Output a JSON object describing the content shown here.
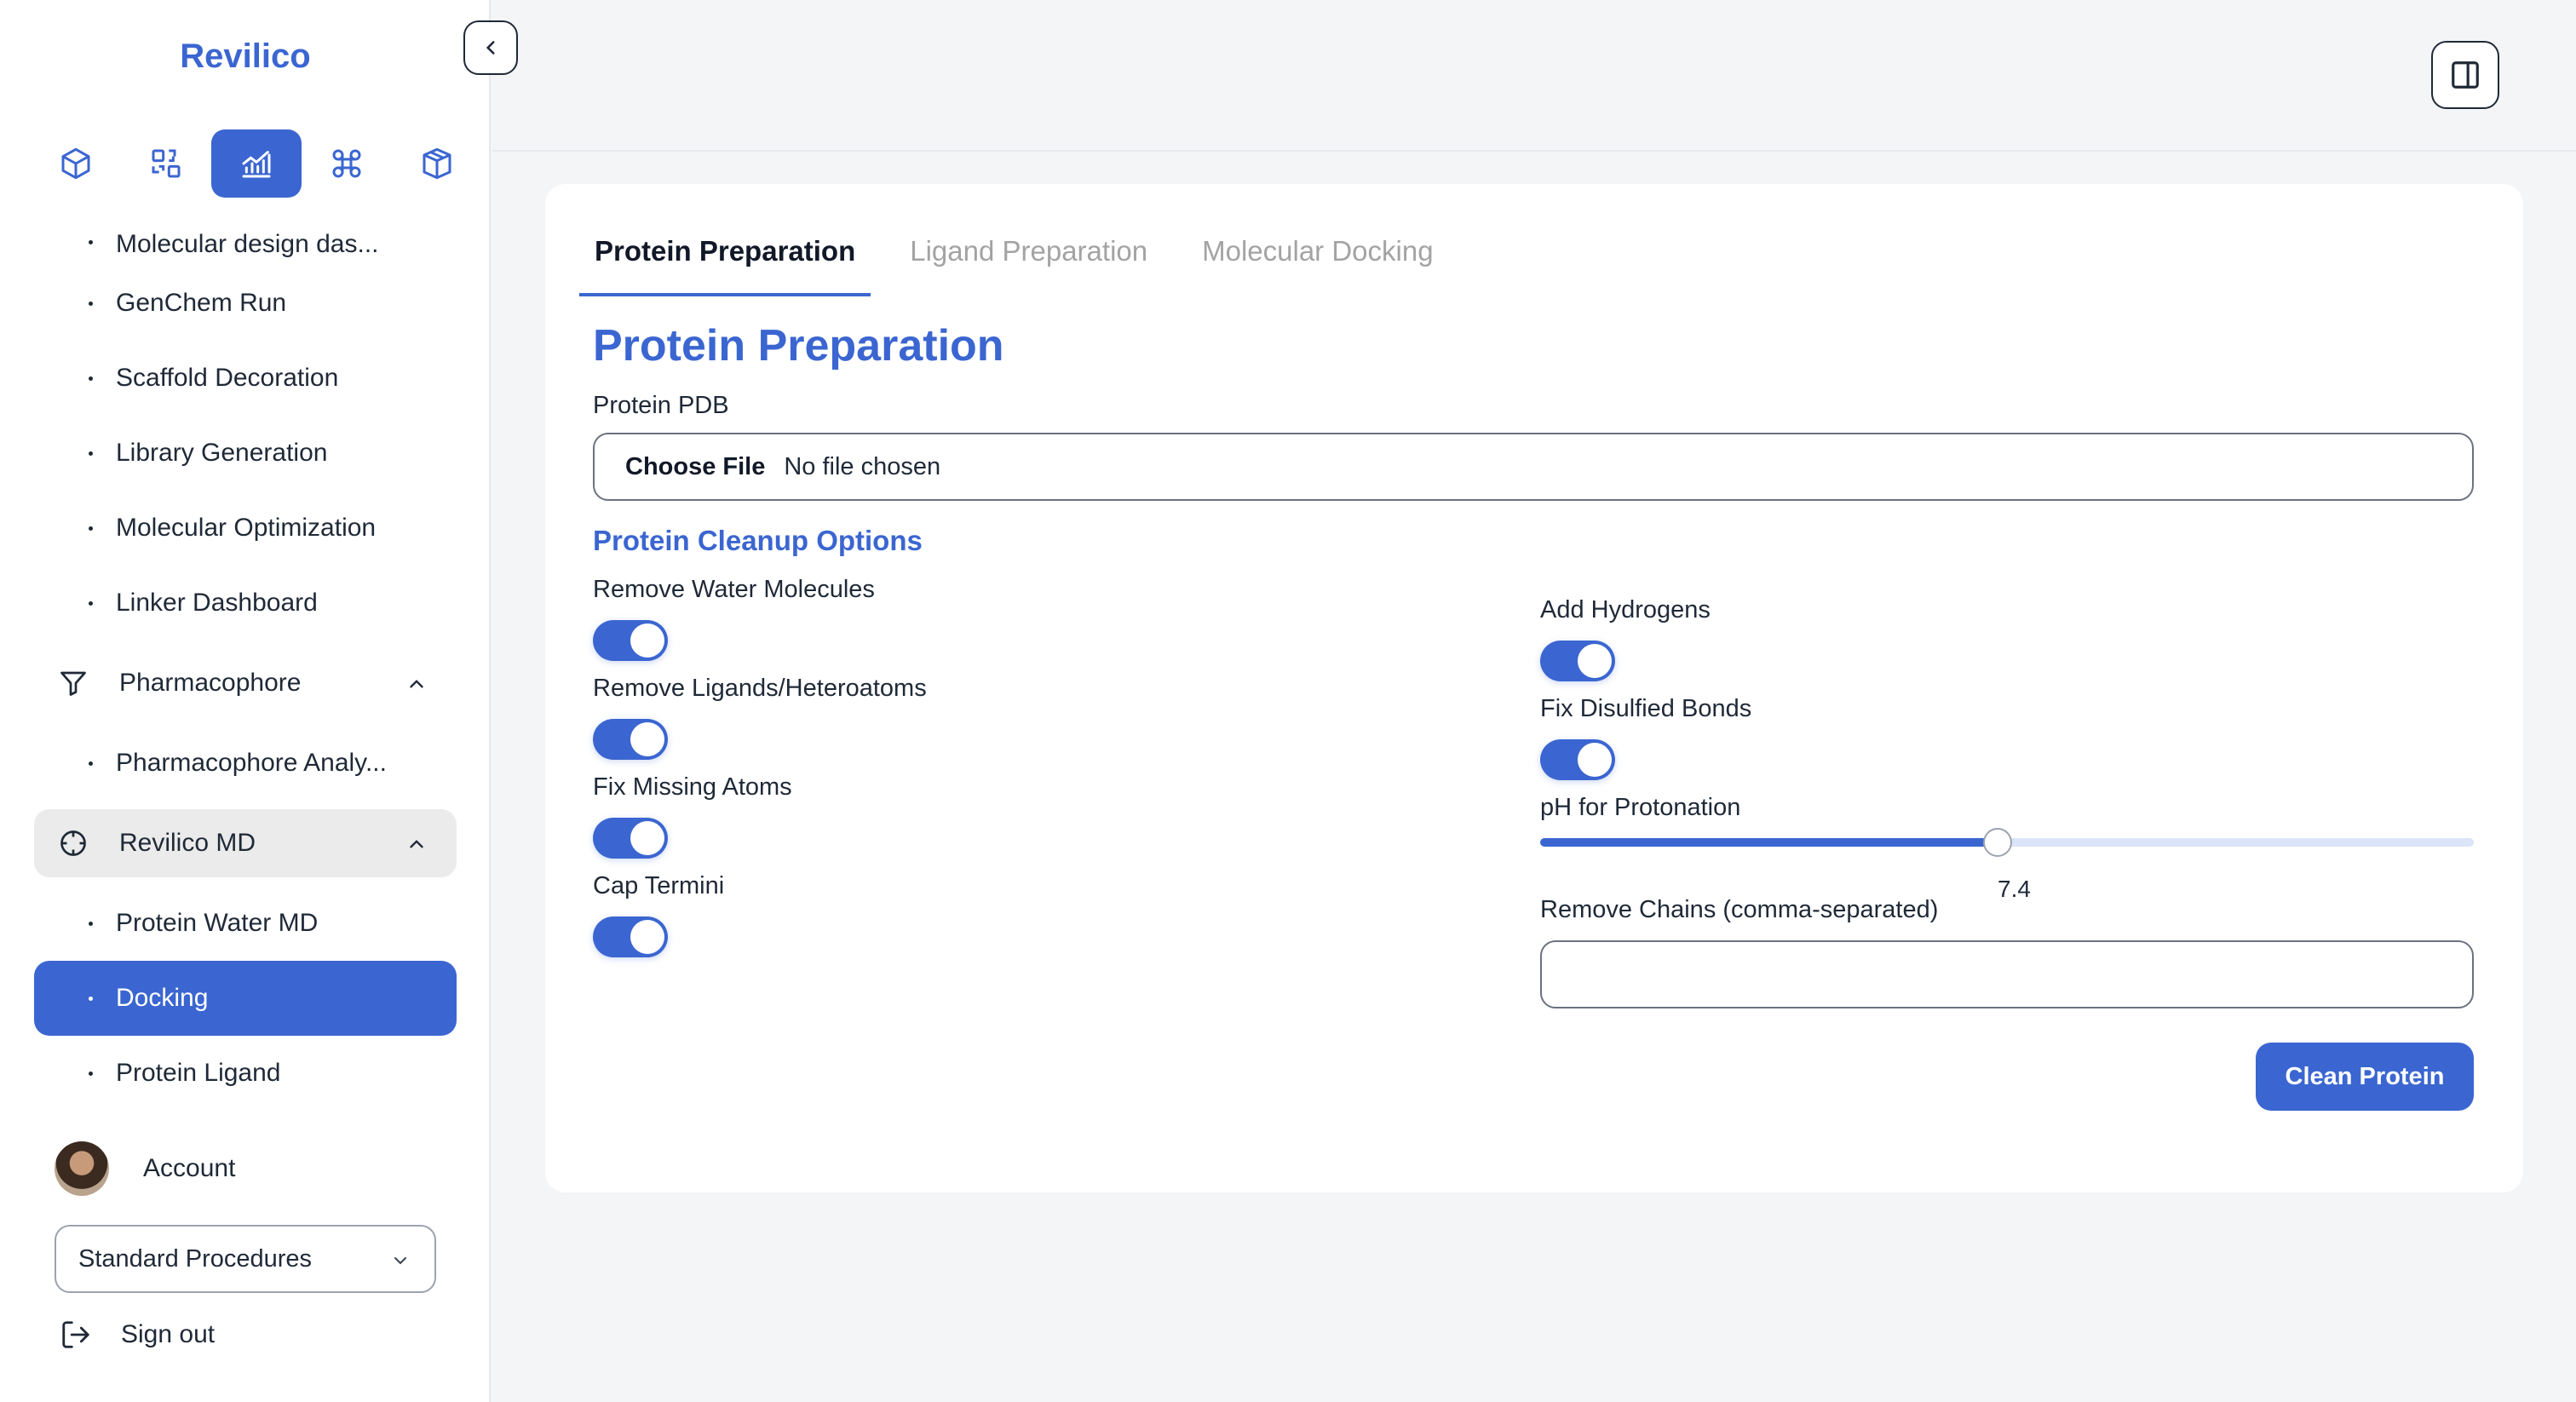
{
  "app": {
    "brand": "Revilico"
  },
  "sidebar": {
    "icon_tabs": [
      {
        "icon": "cube-icon",
        "active": false
      },
      {
        "icon": "scan-icon",
        "active": false
      },
      {
        "icon": "chart-icon",
        "active": true
      },
      {
        "icon": "command-icon",
        "active": false
      },
      {
        "icon": "package-icon",
        "active": false
      }
    ],
    "items_top": [
      "Molecular design das...",
      "GenChem Run",
      "Scaffold Decoration",
      "Library Generation",
      "Molecular Optimization",
      "Linker Dashboard"
    ],
    "group_pharmacophore": {
      "label": "Pharmacophore",
      "icon": "filter-icon",
      "items": [
        "Pharmacophore Analy..."
      ]
    },
    "group_md": {
      "label": "Revilico MD",
      "icon": "crosshair-icon",
      "items": [
        "Protein Water MD",
        "Docking",
        "Protein Ligand"
      ],
      "active_item": "Docking"
    },
    "account_label": "Account",
    "procedure_select": "Standard Procedures",
    "signout_label": "Sign out"
  },
  "main": {
    "tabs": [
      "Protein Preparation",
      "Ligand Preparation",
      "Molecular Docking"
    ],
    "active_tab": "Protein Preparation",
    "title": "Protein Preparation",
    "pdb_label": "Protein PDB",
    "file_button": "Choose File",
    "file_status": "No file chosen",
    "cleanup_title": "Protein Cleanup Options",
    "left_toggles": [
      {
        "label": "Remove Water Molecules",
        "on": true
      },
      {
        "label": "Remove Ligands/Heteroatoms",
        "on": true
      },
      {
        "label": "Fix Missing Atoms",
        "on": true
      },
      {
        "label": "Cap Termini",
        "on": true
      }
    ],
    "right_toggles": [
      {
        "label": "Add Hydrogens",
        "on": true
      },
      {
        "label": "Fix Disulfied Bonds",
        "on": true
      }
    ],
    "ph_label": "pH for Protonation",
    "ph_value": "7.4",
    "ph_fraction": 0.49,
    "chains_label": "Remove Chains (comma-separated)",
    "chains_value": "",
    "submit_label": "Clean Protein"
  },
  "colors": {
    "accent": "#3b66d1",
    "background": "#f4f5f7",
    "muted_tab": "#a3a3a3"
  }
}
